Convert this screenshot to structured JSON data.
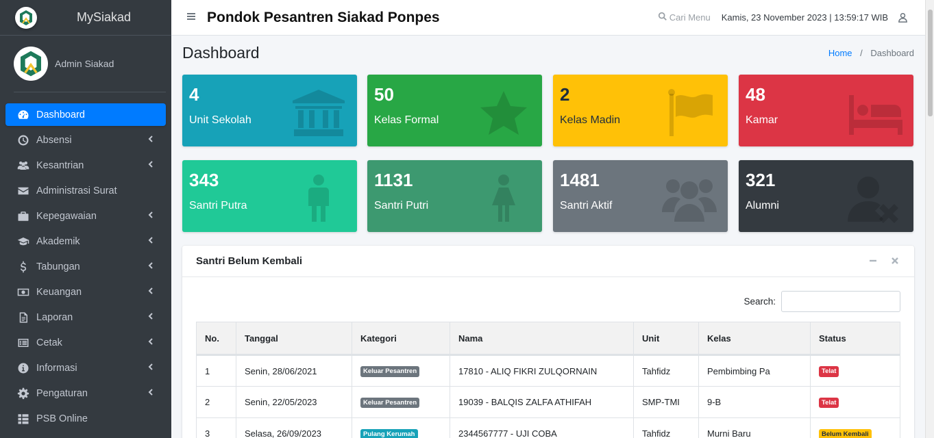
{
  "sidebar": {
    "brand": "MySiakad",
    "user_name": "Admin Siakad",
    "items": [
      {
        "label": "Dashboard",
        "icon": "tachometer-icon"
      },
      {
        "label": "Absensi",
        "icon": "clock-icon"
      },
      {
        "label": "Kesantrian",
        "icon": "users-icon"
      },
      {
        "label": "Administrasi Surat",
        "icon": "envelope-icon"
      },
      {
        "label": "Kepegawaian",
        "icon": "briefcase-icon"
      },
      {
        "label": "Akademik",
        "icon": "graduation-cap-icon"
      },
      {
        "label": "Tabungan",
        "icon": "dollar-icon"
      },
      {
        "label": "Keuangan",
        "icon": "money-bill-icon"
      },
      {
        "label": "Laporan",
        "icon": "file-icon"
      },
      {
        "label": "Cetak",
        "icon": "list-alt-icon"
      },
      {
        "label": "Informasi",
        "icon": "info-circle-icon"
      },
      {
        "label": "Pengaturan",
        "icon": "cog-icon"
      },
      {
        "label": "PSB Online",
        "icon": "th-list-icon"
      }
    ]
  },
  "header": {
    "title": "Pondok Pesantren Siakad Ponpes",
    "search_label": "Cari Menu",
    "datetime": "Kamis, 23 November 2023 | 13:59:17 WIB"
  },
  "content": {
    "page_title": "Dashboard",
    "breadcrumb": {
      "home": "Home",
      "current": "Dashboard",
      "separator": "/"
    }
  },
  "stats": [
    {
      "value": "4",
      "label": "Unit Sekolah",
      "color": "#17a2b8",
      "icon": "university-icon"
    },
    {
      "value": "50",
      "label": "Kelas Formal",
      "color": "#28a745",
      "icon": "star-icon"
    },
    {
      "value": "2",
      "label": "Kelas Madin",
      "color": "#ffc107",
      "icon": "flag-icon"
    },
    {
      "value": "48",
      "label": "Kamar",
      "color": "#dc3545",
      "icon": "bed-icon"
    },
    {
      "value": "343",
      "label": "Santri Putra",
      "color": "#20c997",
      "icon": "male-icon"
    },
    {
      "value": "1131",
      "label": "Santri Putri",
      "color": "#3d9970",
      "icon": "female-icon"
    },
    {
      "value": "1481",
      "label": "Santri Aktif",
      "color": "#6c757d",
      "icon": "users-icon"
    },
    {
      "value": "321",
      "label": "Alumni",
      "color": "#343a40",
      "icon": "user-times-icon"
    }
  ],
  "card": {
    "title": "Santri Belum Kembali",
    "search_label": "Search:",
    "search_value": "",
    "columns": [
      "No.",
      "Tanggal",
      "Kategori",
      "Nama",
      "Unit",
      "Kelas",
      "Status"
    ],
    "rows": [
      {
        "no": "1",
        "tanggal": "Senin, 28/06/2021",
        "kategori": "Keluar Pesantren",
        "nama": "17810 - ALIQ FIKRI ZULQORNAIN",
        "unit": "Tahfidz",
        "kelas": "Pembimbing Pa",
        "status": "Telat"
      },
      {
        "no": "2",
        "tanggal": "Senin, 22/05/2023",
        "kategori": "Keluar Pesantren",
        "nama": "19039 - BALQIS ZALFA ATHIFAH",
        "unit": "SMP-TMI",
        "kelas": "9-B",
        "status": "Telat"
      },
      {
        "no": "3",
        "tanggal": "Selasa, 26/09/2023",
        "kategori": "Pulang Kerumah",
        "nama": "2344567777 - UJI COBA",
        "unit": "Tahfidz",
        "kelas": "Murni Baru",
        "status": "Belum Kembali"
      }
    ]
  }
}
